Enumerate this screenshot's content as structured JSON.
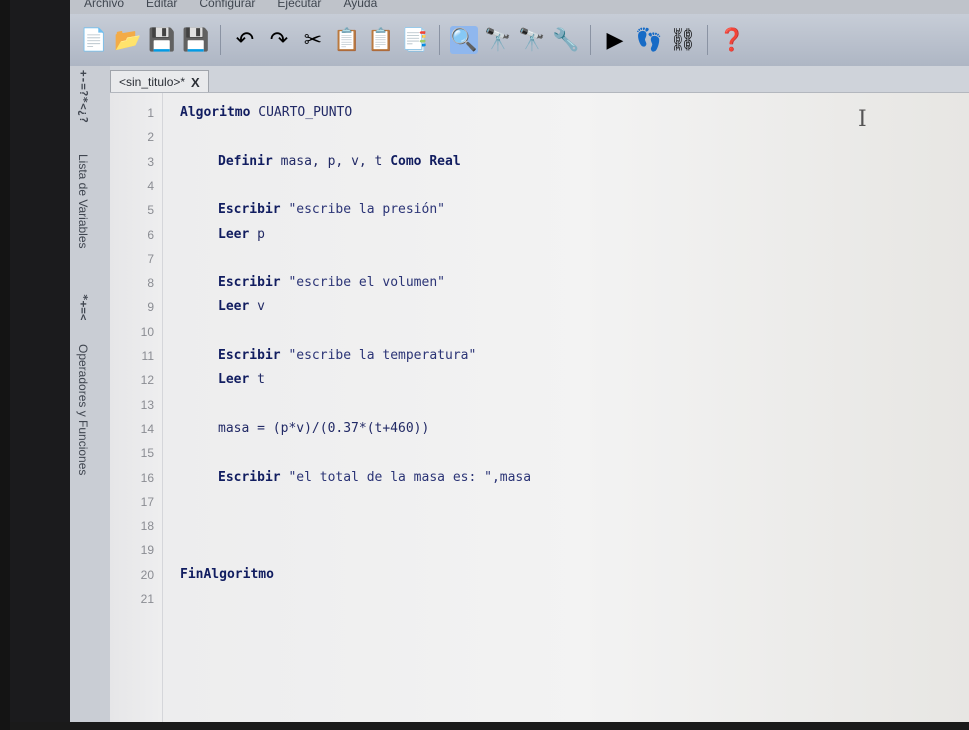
{
  "menu": [
    "Archivo",
    "Editar",
    "Configurar",
    "Ejecutar",
    "Ayuda"
  ],
  "toolbar": [
    {
      "icon": "new-file-icon",
      "glyph": "📄"
    },
    {
      "icon": "open-icon",
      "glyph": "📂"
    },
    {
      "icon": "save-icon",
      "glyph": "💾"
    },
    {
      "icon": "save-as-icon",
      "glyph": "💾"
    },
    {
      "icon": "undo-icon",
      "glyph": "↶"
    },
    {
      "icon": "redo-icon",
      "glyph": "↷"
    },
    {
      "icon": "cut-icon",
      "glyph": "✂"
    },
    {
      "icon": "copy-icon",
      "glyph": "📋"
    },
    {
      "icon": "paste-icon",
      "glyph": "📋"
    },
    {
      "icon": "indent-icon",
      "glyph": "📑"
    },
    {
      "icon": "search-icon",
      "glyph": "🔍",
      "active": true
    },
    {
      "icon": "find-icon",
      "glyph": "🔭"
    },
    {
      "icon": "find-next-icon",
      "glyph": "🔭"
    },
    {
      "icon": "replace-icon",
      "glyph": "🔧"
    },
    {
      "icon": "run-icon",
      "glyph": "▶"
    },
    {
      "icon": "step-icon",
      "glyph": "👣"
    },
    {
      "icon": "flowchart-icon",
      "glyph": "⛓"
    },
    {
      "icon": "help-icon",
      "glyph": "❓"
    }
  ],
  "tab": {
    "title": "<sin_titulo>*",
    "close": "X"
  },
  "sidepanel": {
    "vars_symbols": "+-=?*<¿?",
    "vars_label": "Lista de Variables",
    "ops_symbols": "*+=<",
    "ops_label": "Operadores y Funciones"
  },
  "code_lines": [
    {
      "n": "1",
      "tokens": [
        [
          "kw",
          "Algoritmo "
        ],
        [
          "id",
          "CUARTO_PUNTO"
        ]
      ],
      "indent": 0
    },
    {
      "n": "2",
      "tokens": [],
      "indent": 0
    },
    {
      "n": "3",
      "tokens": [
        [
          "kw",
          "Definir "
        ],
        [
          "id",
          "masa, p, v, t "
        ],
        [
          "kw",
          "Como Real"
        ]
      ],
      "indent": 1
    },
    {
      "n": "4",
      "tokens": [],
      "indent": 0
    },
    {
      "n": "5",
      "tokens": [
        [
          "kw",
          "Escribir "
        ],
        [
          "str",
          "\"escribe la presión\""
        ]
      ],
      "indent": 1
    },
    {
      "n": "6",
      "tokens": [
        [
          "kw",
          "Leer "
        ],
        [
          "id",
          "p"
        ]
      ],
      "indent": 1
    },
    {
      "n": "7",
      "tokens": [],
      "indent": 0
    },
    {
      "n": "8",
      "tokens": [
        [
          "kw",
          "Escribir "
        ],
        [
          "str",
          "\"escribe el volumen\""
        ]
      ],
      "indent": 1
    },
    {
      "n": "9",
      "tokens": [
        [
          "kw",
          "Leer "
        ],
        [
          "id",
          "v"
        ]
      ],
      "indent": 1
    },
    {
      "n": "10",
      "tokens": [],
      "indent": 0
    },
    {
      "n": "11",
      "tokens": [
        [
          "kw",
          "Escribir "
        ],
        [
          "str",
          "\"escribe la temperatura\""
        ]
      ],
      "indent": 1
    },
    {
      "n": "12",
      "tokens": [
        [
          "kw",
          "Leer "
        ],
        [
          "id",
          "t"
        ]
      ],
      "indent": 1
    },
    {
      "n": "13",
      "tokens": [],
      "indent": 0
    },
    {
      "n": "14",
      "tokens": [
        [
          "id",
          "masa = (p*v)/(0.37*(t+460))"
        ]
      ],
      "indent": 1
    },
    {
      "n": "15",
      "tokens": [],
      "indent": 0
    },
    {
      "n": "16",
      "tokens": [
        [
          "kw",
          "Escribir "
        ],
        [
          "str",
          "\"el total de la masa es: \",masa"
        ]
      ],
      "indent": 1
    },
    {
      "n": "17",
      "tokens": [],
      "indent": 0
    },
    {
      "n": "18",
      "tokens": [],
      "indent": 0
    },
    {
      "n": "19",
      "tokens": [],
      "indent": 0
    },
    {
      "n": "20",
      "tokens": [
        [
          "kw",
          "FinAlgoritmo"
        ]
      ],
      "indent": 0
    },
    {
      "n": "21",
      "tokens": [],
      "indent": 0
    }
  ]
}
